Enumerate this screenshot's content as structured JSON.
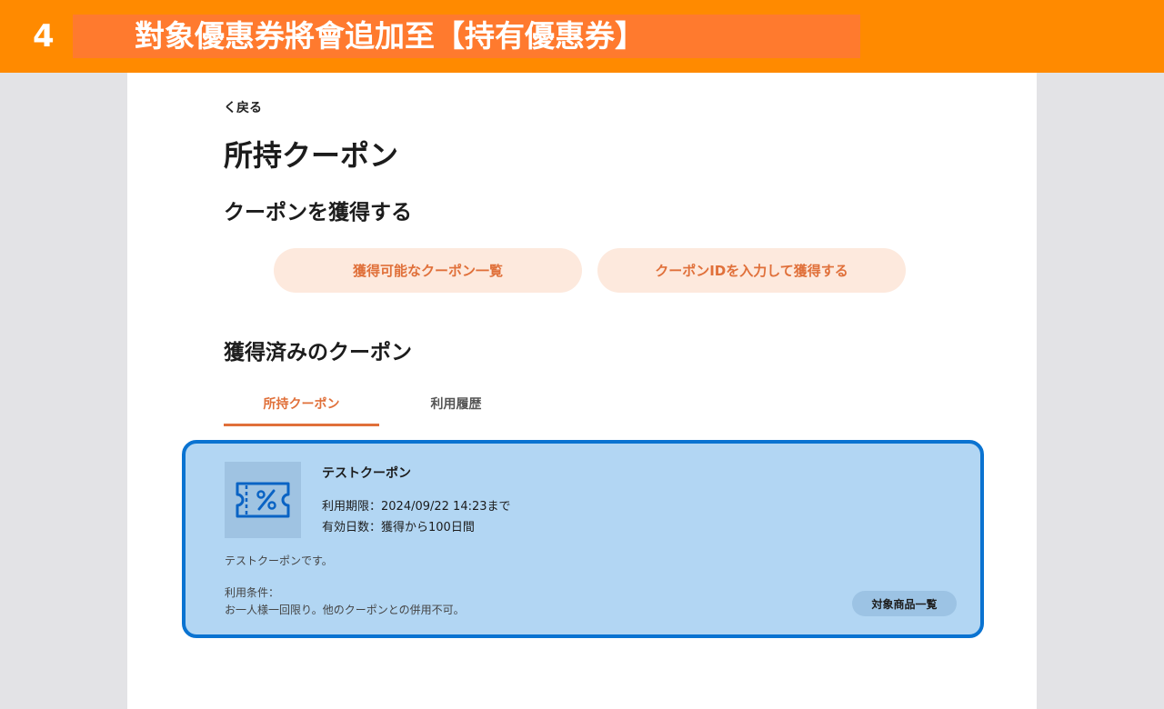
{
  "banner": {
    "step": "4",
    "title": "對象優惠券將會追加至【持有優惠券】"
  },
  "page": {
    "back_label": "く戻る",
    "title": "所持クーポン",
    "get_section_title": "クーポンを獲得する",
    "buttons": {
      "available_list": "獲得可能なクーポン一覧",
      "enter_id": "クーポンIDを入力して獲得する"
    },
    "owned_section_title": "獲得済みのクーポン",
    "tabs": [
      {
        "label": "所持クーポン",
        "active": true
      },
      {
        "label": "利用履歴",
        "active": false
      }
    ],
    "coupon": {
      "name": "テストクーポン",
      "expiry": "利用期限：2024/09/22 14:23まで",
      "valid_days": "有効日数：獲得から100日間",
      "description": "テストクーポンです。",
      "conditions_label": "利用条件：",
      "conditions": "お一人様一回限り。他のクーポンとの併用不可。",
      "target_button": "対象商品一覧",
      "icon": "percent-ticket-icon"
    }
  },
  "colors": {
    "banner": "#ff8a00",
    "accent": "#e0703a",
    "highlight_border": "#0a73d1",
    "highlight_fill": "#b2d6f3"
  }
}
